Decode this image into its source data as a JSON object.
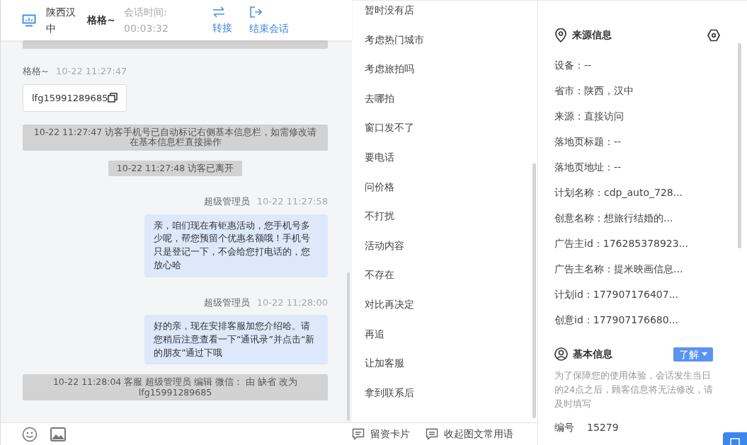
{
  "header": {
    "location": "陕西汉中",
    "visitor": "格格~",
    "duration_label": "会话时间:",
    "duration": "00:03:32",
    "actions": [
      {
        "kind": "transfer",
        "label": "转接"
      },
      {
        "kind": "end",
        "label": "结束会话"
      }
    ]
  },
  "messages": [
    {
      "kind": "cut"
    },
    {
      "kind": "visitor",
      "sender": "格格~",
      "time": "10-22 11:27:47",
      "text": "lfg15991289685"
    },
    {
      "kind": "system",
      "text": "10-22 11:27:47 访客手机号已自动标记右侧基本信息栏，如需修改请在基本信息栏直接操作"
    },
    {
      "kind": "system",
      "text": "10-22 11:27:48 访客已离开"
    },
    {
      "kind": "agent",
      "sender": "超级管理员",
      "time": "10-22 11:27:58",
      "text": "亲，咱们现在有钜惠活动，您手机号多少呢，帮您预留个优惠名额哦！手机号只是登记一下，不会给您打电话的，您放心哈"
    },
    {
      "kind": "agent",
      "sender": "超级管理员",
      "time": "10-22 11:28:00",
      "text": "好的亲，现在安排客服加您介绍哈。请您稍后注意查看一下“通讯录”并点击“新的朋友”通过下哦"
    },
    {
      "kind": "system",
      "text": "10-22 11:28:04 客服 超级管理员 编辑 微信： 由 缺省 改为 lfg15991289685"
    }
  ],
  "quick_phrases": [
    "暂时没有店",
    "考虑热门城市",
    "考虑旅拍吗",
    "去哪拍",
    "窗口发不了",
    "要电话",
    "问价格",
    "不打扰",
    "活动内容",
    "不存在",
    "对比再决定",
    "再追",
    "让加客服",
    "拿到联系后"
  ],
  "toolbar": [
    {
      "kind": "card",
      "label": "留资卡片"
    },
    {
      "kind": "collapse",
      "label": "收起图文常用语"
    }
  ],
  "source_info": {
    "title": "来源信息",
    "fields": [
      "设备：--",
      "省市：陕西，汉中",
      "来源：直接访问",
      "落地页标题：--",
      "落地页地址：--",
      "计划名称：cdp_auto_728...",
      "创意名称：想旅行结婚的...",
      "广告主id：176285378923...",
      "广告主名称：提米映画信息...",
      "计划id：177907176407...",
      "创意id：177907176680..."
    ]
  },
  "basic_info": {
    "title": "基本信息",
    "button": "了解",
    "notice": "为了保障您的使用体验，会话发生当日的24点之后，顾客信息将无法修改，请及时填写",
    "fields": [
      {
        "label": "编号",
        "value": "15279"
      }
    ]
  }
}
